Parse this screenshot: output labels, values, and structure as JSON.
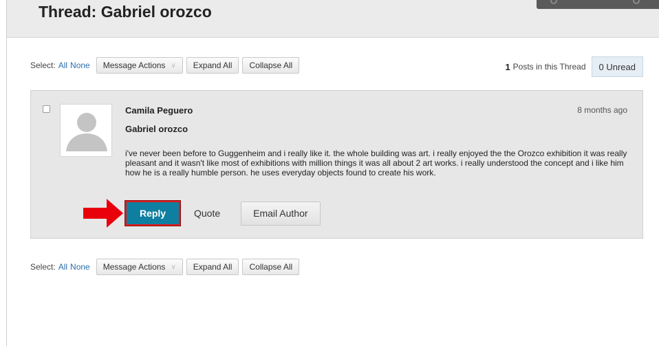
{
  "page": {
    "title": "Thread: Gabriel orozco"
  },
  "toolbar": {
    "select_label": "Select:",
    "all_link": "All",
    "none_link": "None",
    "message_actions": "Message Actions",
    "expand_all": "Expand All",
    "collapse_all": "Collapse All"
  },
  "thread_stats": {
    "post_count": "1",
    "post_count_label": "Posts in this Thread",
    "unread": "0 Unread"
  },
  "post": {
    "author": "Camila Peguero",
    "timestamp": "8 months ago",
    "subject": "Gabriel orozco",
    "body": "i've never been before to Guggenheim and i really like it. the whole building was art. i really enjoyed the the Orozco exhibition it was really pleasant and it wasn't like most of exhibitions with million things it was all about 2 art works. i really understood the concept and i like him how he is a really humble person. he uses everyday objects found to create his work.",
    "actions": {
      "reply": "Reply",
      "quote": "Quote",
      "email_author": "Email Author"
    }
  },
  "colors": {
    "reply_button": "#0f7fa1",
    "highlight_border": "#e01b1b",
    "arrow": "#e8000b",
    "link": "#2a6fad"
  },
  "icons": [
    "avatar-placeholder-icon",
    "chevron-down-icon",
    "red-arrow-icon",
    "checkbox-icon"
  ]
}
